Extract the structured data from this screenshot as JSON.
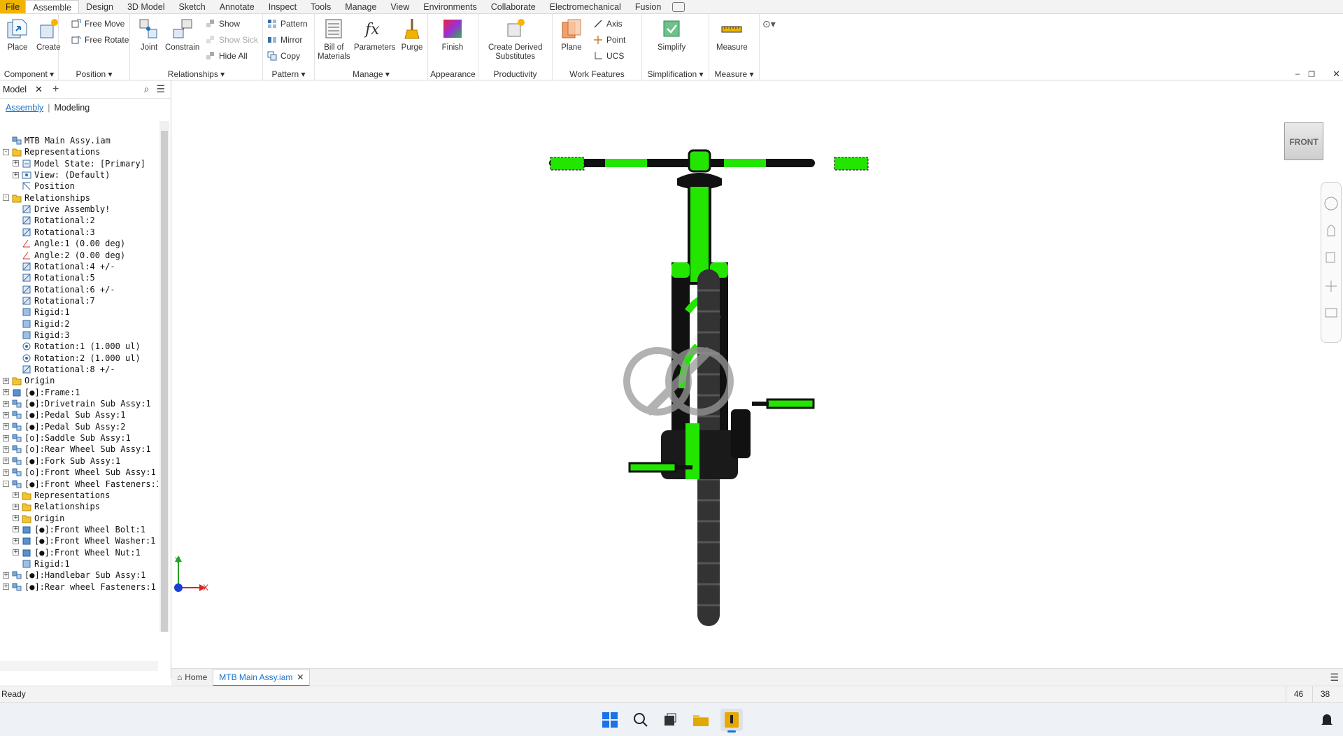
{
  "menubar": {
    "tabs": [
      "File",
      "Assemble",
      "Design",
      "3D Model",
      "Sketch",
      "Annotate",
      "Inspect",
      "Tools",
      "Manage",
      "View",
      "Environments",
      "Collaborate",
      "Electromechanical",
      "Fusion"
    ],
    "active": "Assemble"
  },
  "ribbon": {
    "component": {
      "label": "Component",
      "place": "Place",
      "create": "Create"
    },
    "position": {
      "label": "Position",
      "free_move": "Free Move",
      "free_rotate": "Free Rotate"
    },
    "relationships": {
      "label": "Relationships",
      "joint": "Joint",
      "constrain": "Constrain",
      "show": "Show",
      "show_sick": "Show Sick",
      "hide_all": "Hide All"
    },
    "pattern": {
      "label": "Pattern",
      "pattern": "Pattern",
      "mirror": "Mirror",
      "copy": "Copy"
    },
    "manage": {
      "label": "Manage",
      "bom_1": "Bill of",
      "bom_2": "Materials",
      "parameters": "Parameters",
      "purge": "Purge"
    },
    "appearance": {
      "label": "Appearance",
      "finish": "Finish"
    },
    "productivity": {
      "label": "Productivity",
      "cds_1": "Create Derived",
      "cds_2": "Substitutes"
    },
    "work_features": {
      "label": "Work Features",
      "plane": "Plane",
      "axis": "Axis",
      "point": "Point",
      "ucs": "UCS"
    },
    "simplification": {
      "label": "Simplification",
      "simplify": "Simplify"
    },
    "measure": {
      "label": "Measure",
      "measure": "Measure"
    }
  },
  "browser": {
    "title": "Model",
    "mode_assembly": "Assembly",
    "mode_modeling": "Modeling",
    "tree": [
      {
        "label": "MTB Main Assy.iam",
        "indent": 0,
        "exp": "",
        "icon": "assembly"
      },
      {
        "label": "Representations",
        "indent": 0,
        "exp": "-",
        "icon": "folder"
      },
      {
        "label": "Model State: [Primary]",
        "indent": 1,
        "exp": "+",
        "icon": "state"
      },
      {
        "label": "View: (Default)",
        "indent": 1,
        "exp": "+",
        "icon": "view"
      },
      {
        "label": "Position",
        "indent": 1,
        "exp": "",
        "icon": "position"
      },
      {
        "label": "Relationships",
        "indent": 0,
        "exp": "-",
        "icon": "folder"
      },
      {
        "label": "Drive Assembly!",
        "indent": 1,
        "exp": "",
        "icon": "joint"
      },
      {
        "label": "Rotational:2",
        "indent": 1,
        "exp": "",
        "icon": "joint"
      },
      {
        "label": "Rotational:3",
        "indent": 1,
        "exp": "",
        "icon": "joint"
      },
      {
        "label": "Angle:1 (0.00 deg)",
        "indent": 1,
        "exp": "",
        "icon": "angle"
      },
      {
        "label": "Angle:2 (0.00 deg)",
        "indent": 1,
        "exp": "",
        "icon": "angle"
      },
      {
        "label": "Rotational:4 +/-",
        "indent": 1,
        "exp": "",
        "icon": "joint"
      },
      {
        "label": "Rotational:5",
        "indent": 1,
        "exp": "",
        "icon": "joint"
      },
      {
        "label": "Rotational:6 +/-",
        "indent": 1,
        "exp": "",
        "icon": "joint"
      },
      {
        "label": "Rotational:7",
        "indent": 1,
        "exp": "",
        "icon": "joint"
      },
      {
        "label": "Rigid:1",
        "indent": 1,
        "exp": "",
        "icon": "rigid"
      },
      {
        "label": "Rigid:2",
        "indent": 1,
        "exp": "",
        "icon": "rigid"
      },
      {
        "label": "Rigid:3",
        "indent": 1,
        "exp": "",
        "icon": "rigid"
      },
      {
        "label": "Rotation:1 (1.000 ul)",
        "indent": 1,
        "exp": "",
        "icon": "rotation"
      },
      {
        "label": "Rotation:2 (1.000 ul)",
        "indent": 1,
        "exp": "",
        "icon": "rotation"
      },
      {
        "label": "Rotational:8 +/-",
        "indent": 1,
        "exp": "",
        "icon": "joint"
      },
      {
        "label": "Origin",
        "indent": 0,
        "exp": "+",
        "icon": "folder"
      },
      {
        "label": "[●]:Frame:1",
        "indent": 0,
        "exp": "+",
        "icon": "part"
      },
      {
        "label": "[●]:Drivetrain Sub Assy:1",
        "indent": 0,
        "exp": "+",
        "icon": "assembly"
      },
      {
        "label": "[●]:Pedal Sub Assy:1",
        "indent": 0,
        "exp": "+",
        "icon": "assembly"
      },
      {
        "label": "[●]:Pedal Sub Assy:2",
        "indent": 0,
        "exp": "+",
        "icon": "assembly"
      },
      {
        "label": "[o]:Saddle Sub Assy:1",
        "indent": 0,
        "exp": "+",
        "icon": "assembly"
      },
      {
        "label": "[o]:Rear Wheel Sub Assy:1",
        "indent": 0,
        "exp": "+",
        "icon": "assembly"
      },
      {
        "label": "[●]:Fork Sub Assy:1",
        "indent": 0,
        "exp": "+",
        "icon": "assembly"
      },
      {
        "label": "[o]:Front Wheel Sub Assy:1",
        "indent": 0,
        "exp": "+",
        "icon": "assembly"
      },
      {
        "label": "[●]:Front Wheel Fasteners:1",
        "indent": 0,
        "exp": "-",
        "icon": "assembly"
      },
      {
        "label": "Representations",
        "indent": 1,
        "exp": "+",
        "icon": "folder"
      },
      {
        "label": "Relationships",
        "indent": 1,
        "exp": "+",
        "icon": "folder"
      },
      {
        "label": "Origin",
        "indent": 1,
        "exp": "+",
        "icon": "folder"
      },
      {
        "label": "[●]:Front Wheel Bolt:1",
        "indent": 1,
        "exp": "+",
        "icon": "part"
      },
      {
        "label": "[●]:Front Wheel Washer:1",
        "indent": 1,
        "exp": "+",
        "icon": "part"
      },
      {
        "label": "[●]:Front Wheel Nut:1",
        "indent": 1,
        "exp": "+",
        "icon": "part"
      },
      {
        "label": "Rigid:1",
        "indent": 1,
        "exp": "",
        "icon": "rigid"
      },
      {
        "label": "[●]:Handlebar Sub Assy:1",
        "indent": 0,
        "exp": "+",
        "icon": "assembly"
      },
      {
        "label": "[●]:Rear wheel Fasteners:1",
        "indent": 0,
        "exp": "+",
        "icon": "assembly"
      }
    ]
  },
  "viewport": {
    "viewcube": "FRONT",
    "axis_x": "X",
    "axis_y": "Y"
  },
  "doc_tabs": {
    "home": "Home",
    "active": "MTB Main Assy.iam"
  },
  "status": {
    "text": "Ready",
    "n1": "46",
    "n2": "38"
  },
  "colors": {
    "accent": "#1a73c8",
    "model_green": "#22e600",
    "file_tab": "#f0b400"
  }
}
